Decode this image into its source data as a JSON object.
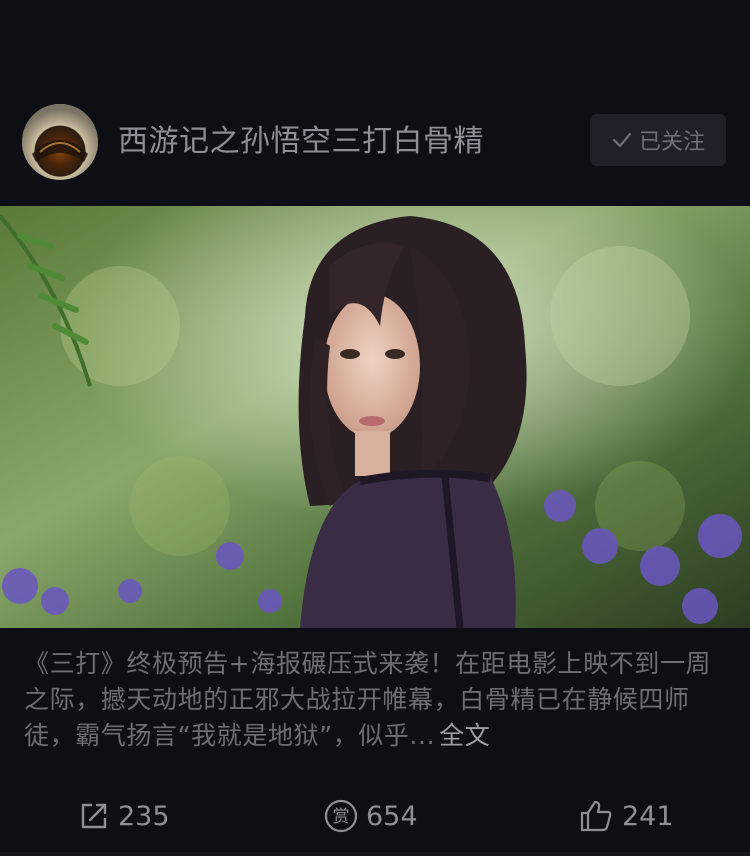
{
  "post": {
    "author_name": "西游记之孙悟空三打白骨精",
    "follow_label": "已关注",
    "description": "《三打》终极预告+海报碾压式来袭！在距电影上映不到一周之际，撼天动地的正邪大战拉开帷幕，白骨精已在静候四师徒，霸气扬言“我就是地狱”，似乎...",
    "more_label": "全文"
  },
  "actions": {
    "share_count": "235",
    "reward_count": "654",
    "reward_icon_text": "赏",
    "like_count": "241"
  },
  "icons": {
    "follow": "check-icon",
    "share": "share-icon",
    "reward": "reward-icon",
    "like": "thumbs-up-icon"
  },
  "colors": {
    "background": "#0e0f14",
    "follow_button": "#1f2128"
  }
}
